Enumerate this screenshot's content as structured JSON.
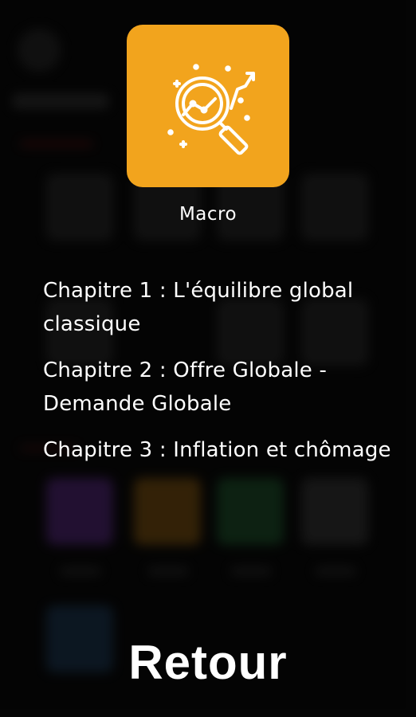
{
  "dialog": {
    "app_icon": "magnifier-chart-icon",
    "app_color": "#f2a41d",
    "app_name": "Macro",
    "chapters": [
      {
        "label": "Chapitre 1 : L'équilibre global classique"
      },
      {
        "label": "Chapitre 2 : Offre Globale - Demande Globale"
      },
      {
        "label": "Chapitre 3 : Inflation et chômage"
      }
    ],
    "back_label": "Retour"
  }
}
